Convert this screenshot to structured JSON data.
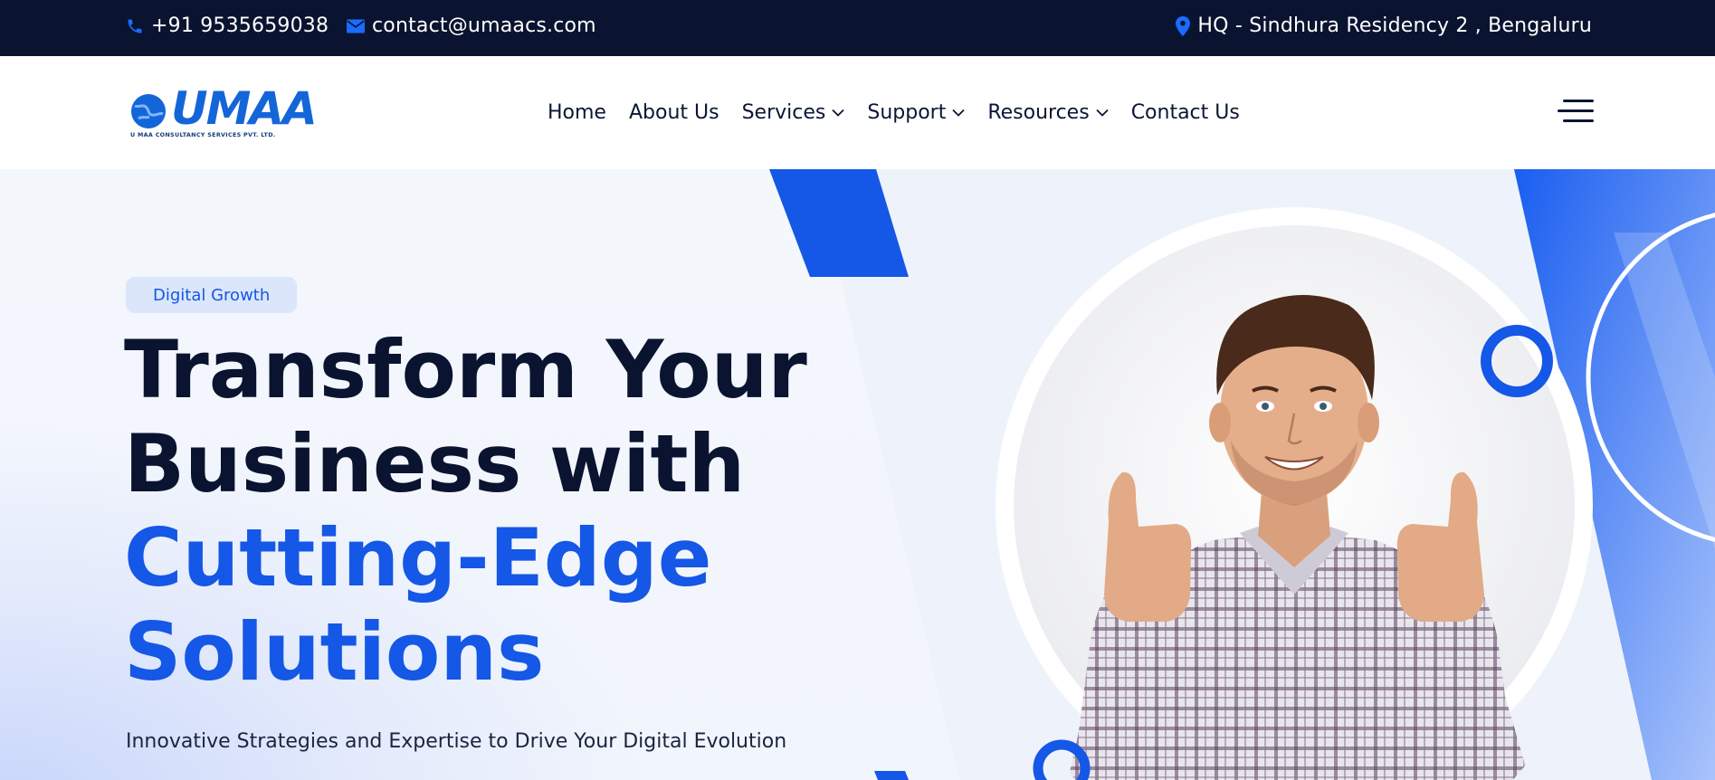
{
  "topbar": {
    "phone": "+91 9535659038",
    "email": "contact@umaacs.com",
    "address": "HQ - Sindhura Residency 2 , Bengaluru",
    "phone_icon": "phone-icon",
    "email_icon": "envelope-icon",
    "address_icon": "map-pin-icon"
  },
  "header": {
    "logo_text": "UMAA",
    "logo_subtitle": "U MAA CONSULTANCY SERVICES PVT. LTD.",
    "nav": [
      {
        "label": "Home",
        "has_dropdown": false
      },
      {
        "label": "About Us",
        "has_dropdown": false
      },
      {
        "label": "Services",
        "has_dropdown": true
      },
      {
        "label": "Support",
        "has_dropdown": true
      },
      {
        "label": "Resources",
        "has_dropdown": true
      },
      {
        "label": "Contact Us",
        "has_dropdown": false
      }
    ],
    "menu_icon": "hamburger-menu-icon"
  },
  "hero": {
    "badge": "Digital Growth",
    "headline_line1": "Transform Your",
    "headline_line2": "Business with",
    "headline_line3": "Cutting-Edge",
    "headline_line4": "Solutions",
    "subheadline": "Innovative Strategies and Expertise to Drive Your Digital Evolution"
  },
  "colors": {
    "topbar_bg": "#0a1430",
    "accent_blue": "#1557e6",
    "heading_dark": "#0a1430",
    "badge_bg": "#dbe6fb"
  }
}
